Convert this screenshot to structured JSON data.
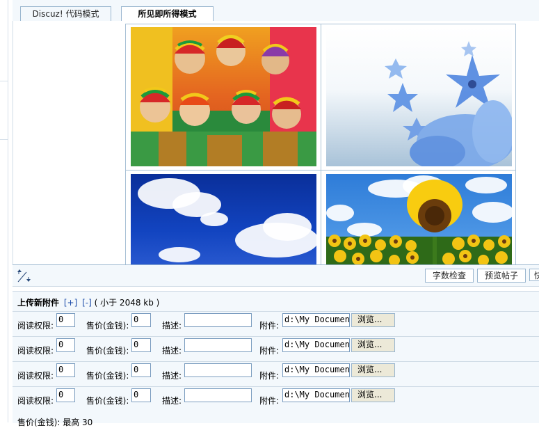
{
  "tabs": [
    {
      "label": "Discuz! 代码模式",
      "active": false
    },
    {
      "label": "所见即所得模式",
      "active": true
    }
  ],
  "editor": {
    "images": [
      {
        "name": "group-photo"
      },
      {
        "name": "blue-flowers"
      },
      {
        "name": "blue-sky-clouds"
      },
      {
        "name": "sunflowers"
      }
    ]
  },
  "toolbar": {
    "word_check": "字数检查",
    "preview_post": "预览帖子",
    "more": "快"
  },
  "attachments": {
    "title": "上传新附件",
    "add": "[+]",
    "remove": "[-]",
    "limit": "( 小于 2048 kb )",
    "read_perm_label": "阅读权限:",
    "price_label": "售价(金钱):",
    "desc_label": "描述:",
    "file_label": "附件:",
    "browse_label": "浏览...",
    "rows": [
      {
        "read_perm": "0",
        "price": "0",
        "desc": "",
        "file": "d:\\My Documents"
      },
      {
        "read_perm": "0",
        "price": "0",
        "desc": "",
        "file": "d:\\My Documents"
      },
      {
        "read_perm": "0",
        "price": "0",
        "desc": "",
        "file": "d:\\My Documents"
      },
      {
        "read_perm": "0",
        "price": "0",
        "desc": "",
        "file": "d:\\My Documents"
      }
    ],
    "footnote": "售价(金钱): 最高 30"
  },
  "colors": {
    "panel_bg": "#f3f8fc",
    "border": "#9ab6cf",
    "link": "#1a4aa8"
  }
}
